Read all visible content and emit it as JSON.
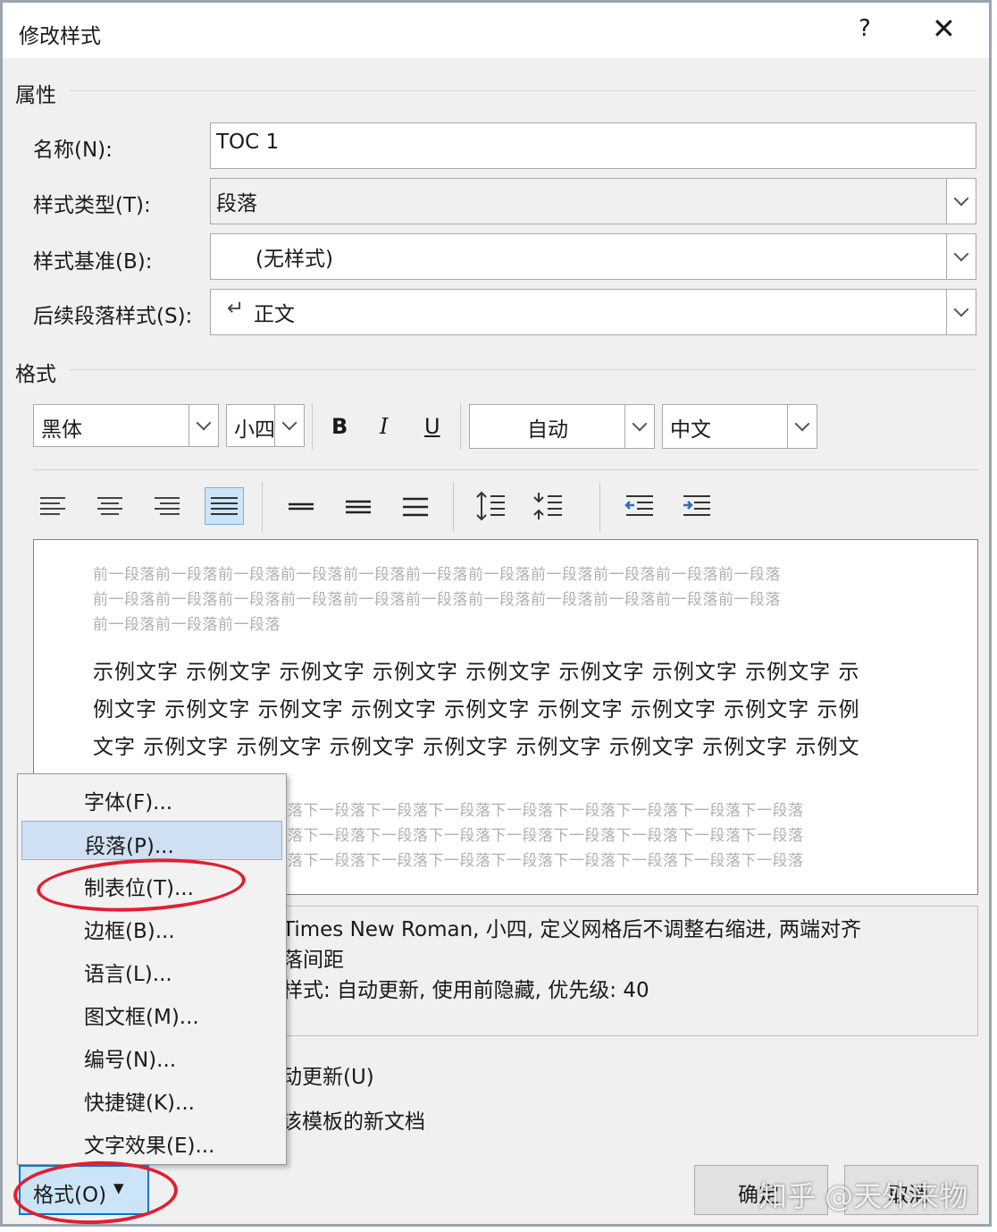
{
  "dialog": {
    "title": "修改样式",
    "help_glyph": "?",
    "close_glyph": "✕"
  },
  "properties": {
    "section_label": "属性",
    "name_label": "名称(N):",
    "name_value": "TOC 1",
    "type_label": "样式类型(T):",
    "type_value": "段落",
    "based_label": "样式基准(B):",
    "based_value": "(无样式)",
    "next_label": "后续段落样式(S):",
    "next_glyph": "↵",
    "next_value": "正文"
  },
  "format": {
    "section_label": "格式",
    "font": "黑体",
    "size": "小四",
    "bold": "B",
    "italic": "I",
    "underline": "U",
    "color": "自动",
    "script": "中文"
  },
  "preview": {
    "prev_lines": [
      "前一段落前一段落前一段落前一段落前一段落前一段落前一段落前一段落前一段落前一段落前一段落",
      "前一段落前一段落前一段落前一段落前一段落前一段落前一段落前一段落前一段落前一段落前一段落",
      "前一段落前一段落前一段落"
    ],
    "sample_lines": [
      "示例文字 示例文字 示例文字 示例文字 示例文字 示例文字 示例文字 示例文字 示",
      "例文字 示例文字 示例文字 示例文字 示例文字 示例文字 示例文字 示例文字 示例",
      "文字 示例文字 示例文字 示例文字 示例文字 示例文字 示例文字 示例文字 示例文"
    ],
    "next_lines": [
      "落下一段落下一段落下一段落下一段落下一段落下一段落下一段落下一段落",
      "落下一段落下一段落下一段落下一段落下一段落下一段落下一段落下一段落",
      "落下一段落下一段落下一段落下一段落下一段落下一段落下一段落下一段落"
    ]
  },
  "description": {
    "line1": "Times New Roman, 小四, 定义网格后不调整右缩进, 两端对齐",
    "line2": "落间距",
    "line3": "样式: 自动更新, 使用前隐藏, 优先级: 40"
  },
  "options": {
    "auto_update": "动更新(U)",
    "new_docs": "该模板的新文档"
  },
  "menu": {
    "items": [
      "字体(F)...",
      "段落(P)...",
      "制表位(T)...",
      "边框(B)...",
      "语言(L)...",
      "图文框(M)...",
      "编号(N)...",
      "快捷键(K)...",
      "文字效果(E)..."
    ],
    "selected_index": 1
  },
  "buttons": {
    "format": "格式(O)",
    "format_arrow": "▾",
    "ok": "确定",
    "cancel": "取消"
  },
  "watermark": "知乎 @天外来物",
  "colors": {
    "accent_red": "#e02030",
    "menu_highlight": "#cfe0f3",
    "dialog_bg": "#f0f0f0"
  }
}
